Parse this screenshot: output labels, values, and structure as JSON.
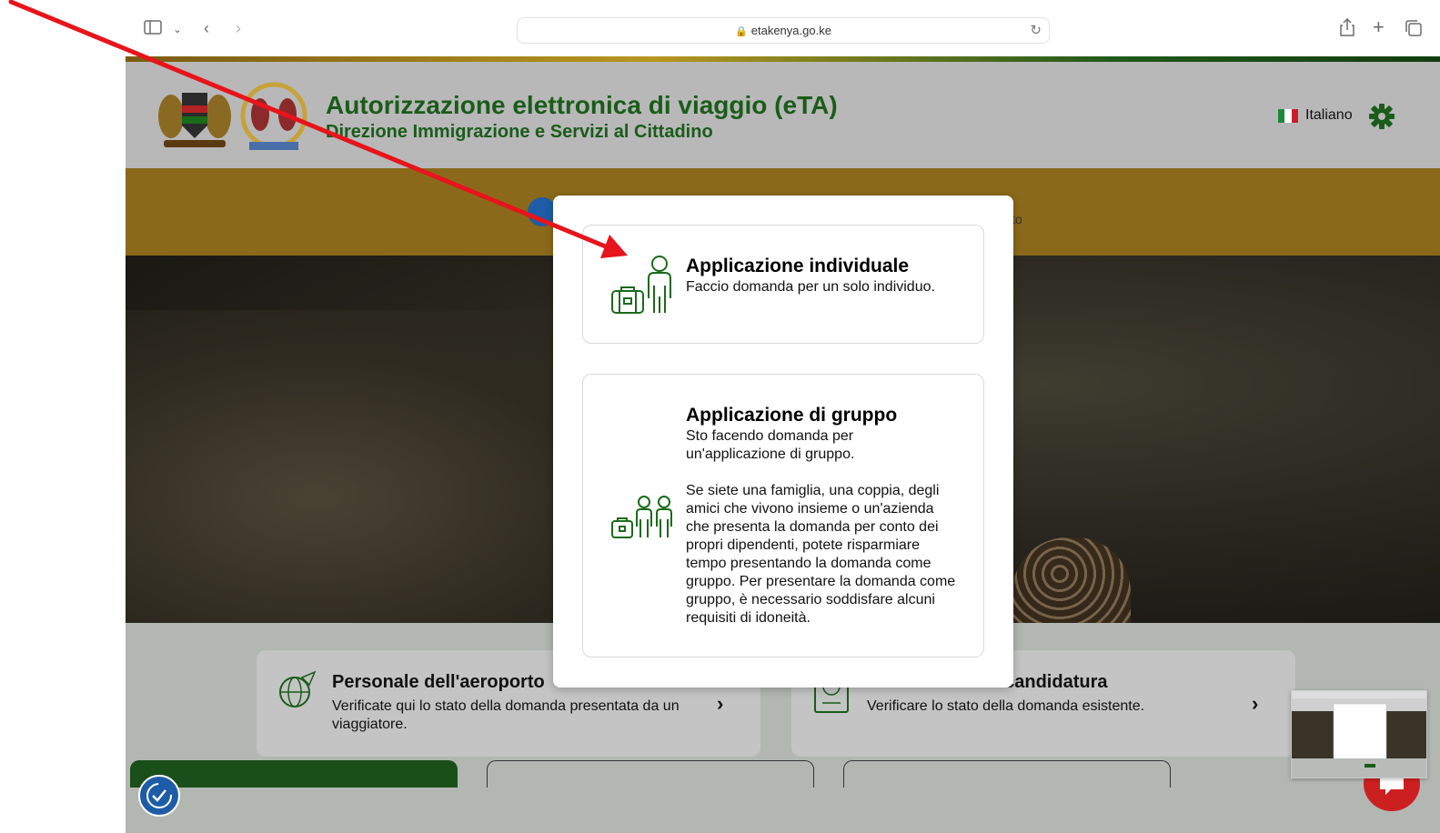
{
  "browser": {
    "url": "etakenya.go.ke"
  },
  "header": {
    "title": "Autorizzazione elettronica di viaggio (eTA)",
    "subtitle": "Direzione Immigrazione e Servizi al Cittadino",
    "language_label": "Italiano"
  },
  "announcement": {
    "visible_fragment": "to"
  },
  "modal": {
    "individual": {
      "title": "Applicazione individuale",
      "description": "Faccio domanda per un solo individuo."
    },
    "group": {
      "title": "Applicazione di gruppo",
      "description_1": "Sto facendo domanda per un'applicazione di gruppo.",
      "description_2": "Se siete una famiglia, una coppia, degli amici che vivono insieme o un'azienda che presenta la domanda per conto dei propri dipendenti, potete risparmiare tempo presentando la domanda come gruppo. Per presentare la domanda come gruppo, è necessario soddisfare alcuni requisiti di idoneità."
    }
  },
  "cards": {
    "airport": {
      "title": "Personale dell'aeroporto",
      "description": "Verificate qui lo stato della domanda presentata da un viaggiatore."
    },
    "check": {
      "title": "Controlla la tua candidatura",
      "description": "Verificare lo stato della domanda esistente."
    }
  },
  "colors": {
    "brand_green": "#1a5c1a",
    "annotation_arrow": "#e8141b",
    "announcement_bar": "#8a6a1a"
  }
}
